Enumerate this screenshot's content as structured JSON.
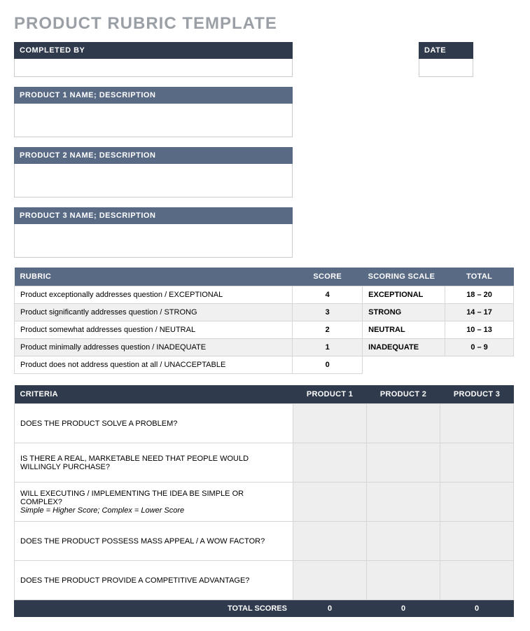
{
  "title": "PRODUCT RUBRIC TEMPLATE",
  "fields": {
    "completed_by_label": "COMPLETED BY",
    "date_label": "DATE",
    "product1_label": "PRODUCT 1 NAME; DESCRIPTION",
    "product2_label": "PRODUCT 2 NAME; DESCRIPTION",
    "product3_label": "PRODUCT 3 NAME; DESCRIPTION"
  },
  "rubric": {
    "headers": {
      "rubric": "RUBRIC",
      "score": "SCORE",
      "scale": "SCORING SCALE",
      "total": "TOTAL"
    },
    "rows": [
      {
        "label": "Product exceptionally addresses question / EXCEPTIONAL",
        "score": "4",
        "scale": "EXCEPTIONAL",
        "total": "18 – 20"
      },
      {
        "label": "Product significantly addresses question / STRONG",
        "score": "3",
        "scale": "STRONG",
        "total": "14 – 17"
      },
      {
        "label": "Product somewhat addresses question / NEUTRAL",
        "score": "2",
        "scale": "NEUTRAL",
        "total": "10 – 13"
      },
      {
        "label": "Product minimally addresses question / INADEQUATE",
        "score": "1",
        "scale": "INADEQUATE",
        "total": "0 – 9"
      },
      {
        "label": "Product does not address question at all / UNACCEPTABLE",
        "score": "0",
        "scale": "",
        "total": ""
      }
    ]
  },
  "criteria": {
    "headers": {
      "criteria": "CRITERIA",
      "p1": "PRODUCT 1",
      "p2": "PRODUCT 2",
      "p3": "PRODUCT 3"
    },
    "rows": [
      {
        "text": "DOES THE PRODUCT SOLVE A PROBLEM?",
        "sub": ""
      },
      {
        "text": "IS THERE A REAL, MARKETABLE NEED THAT PEOPLE WOULD WILLINGLY PURCHASE?",
        "sub": ""
      },
      {
        "text": "WILL EXECUTING / IMPLEMENTING THE IDEA BE SIMPLE OR COMPLEX?",
        "sub": "Simple = Higher Score; Complex = Lower Score"
      },
      {
        "text": "DOES THE PRODUCT POSSESS MASS APPEAL / A WOW FACTOR?",
        "sub": ""
      },
      {
        "text": "DOES THE PRODUCT PROVIDE A COMPETITIVE ADVANTAGE?",
        "sub": ""
      }
    ],
    "footer": {
      "label": "TOTAL SCORES",
      "p1": "0",
      "p2": "0",
      "p3": "0"
    }
  }
}
